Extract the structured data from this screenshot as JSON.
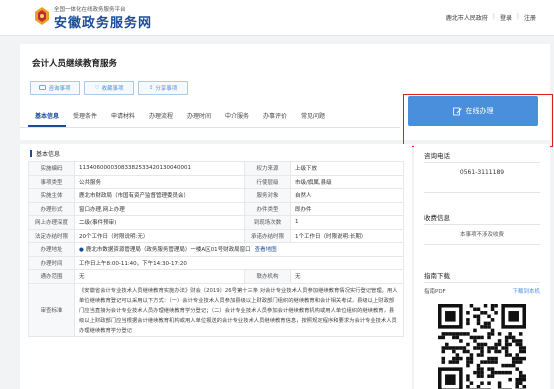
{
  "header": {
    "slogan": "全国一体化在线政务服务平台",
    "site_name": "安徽政务服务网",
    "region": "鹿北市人民政府",
    "login": "登录",
    "register": "注册"
  },
  "service": {
    "title": "会计人员继续教育服务",
    "actions": [
      {
        "label": "咨询事项",
        "icon": "chat-icon"
      },
      {
        "label": "收藏事项",
        "icon": "heart-icon"
      },
      {
        "label": "分享事项",
        "icon": "share-icon"
      }
    ],
    "tabs": [
      "基本信息",
      "受理条件",
      "申请材料",
      "办理流程",
      "办理时间",
      "中介服务",
      "办事评价",
      "常见问题"
    ],
    "active_tab": "基本信息",
    "online_button": "在线办理"
  },
  "info": {
    "section_title": "基本信息",
    "rows": [
      [
        {
          "k": "实施编码"
        },
        {
          "v": "11340600003083382533420130040001"
        },
        {
          "k": "权力来源"
        },
        {
          "v": "上级下放"
        }
      ],
      [
        {
          "k": "事项类型"
        },
        {
          "v": "公共服务"
        },
        {
          "k": "行使层级"
        },
        {
          "v": "市级/旗属,县级"
        }
      ],
      [
        {
          "k": "实施主体"
        },
        {
          "v": "鹿北市财政局（市国有资产监督管理委员会）"
        },
        {
          "k": "服务对象"
        },
        {
          "v": "自然人"
        }
      ],
      [
        {
          "k": "办理形式"
        },
        {
          "v": "窗口办理,网上办理"
        },
        {
          "k": "办件类型"
        },
        {
          "v": "即办件"
        }
      ],
      [
        {
          "k": "网上办理深度"
        },
        {
          "v": "二级(事件预审)"
        },
        {
          "k": "到现场次数"
        },
        {
          "v": "1"
        }
      ],
      [
        {
          "k": "法定办结时限"
        },
        {
          "v": "20个工作日（时限说明:无）"
        },
        {
          "k": "承诺办结时限"
        },
        {
          "v": "1个工作日（时限说明:长期）"
        }
      ]
    ],
    "address_label": "办理地址",
    "address": "鹿北市数据资源管理局（政务服务管理局）一楼A区01号财政局窗口",
    "map_link": "查看地图",
    "time_label": "办理时间",
    "time": "工作日上午8:00-11:40，下午14:30-17:20",
    "intermediary_label": "通办范围",
    "intermediary": "无",
    "fee_label": "联办机构",
    "fee": "无",
    "criteria_label": "审查标准",
    "criteria": "《安徽省会计专业技术人员继续教育实施办法》财会〔2019〕26号第十三条 对会计专业技术人员参加继续教育情况实行登记管理。用人单位继续教育登记可以采用以下方式：（一）会计专业技术人员参加县级以上财政部门组织的继续教育和会计相关考试，县级以上财政部门应当直接为会计专业技术人员办理继续教育学分登记；（二）会计专业技术人员参加会计继续教育机构或用人单位组织的继续教育，县级以上财政部门应当根据会计继续教育机构或用人单位报送的会计专业技术人员继续教育信息，按照规定程序和要求为会计专业技术人员办理继续教育学分登记"
  },
  "side": {
    "consult_title": "咨询电话",
    "phone": "0561-3111189",
    "fee_title": "收费信息",
    "fee_text": "本事项不涉及收费",
    "guide_title": "指南下载",
    "guide_file": "指南PDF",
    "guide_download": "下载到本机"
  },
  "colors": {
    "brand": "#1a4c9a",
    "button": "#4a8fdc",
    "highlight": "#e02020"
  }
}
